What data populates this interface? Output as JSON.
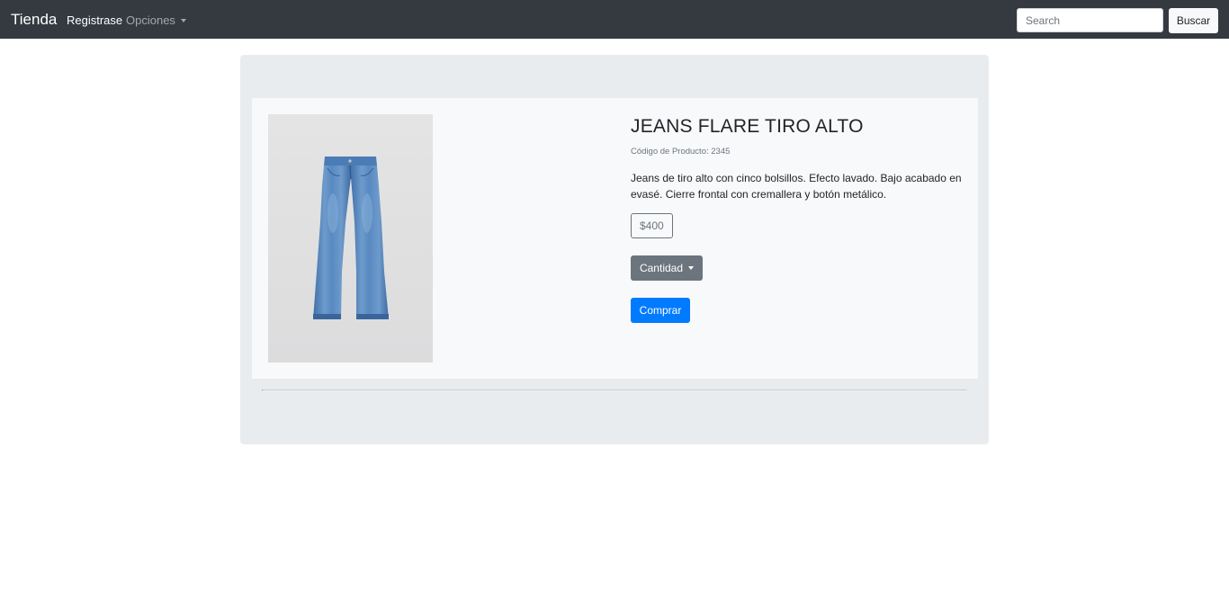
{
  "navbar": {
    "brand": "Tienda",
    "register_link": "Registrase",
    "options_dropdown": "Opciones",
    "search_placeholder": "Search",
    "search_button": "Buscar",
    "background": "#343a40"
  },
  "product": {
    "title": "JEANS FLARE TIRO ALTO",
    "code": "Código de Producto: 2345",
    "description": "Jeans de tiro alto con cinco bolsillos. Efecto lavado. Bajo acabado en evasé. Cierre frontal con cremallera y botón metálico.",
    "price": "$400",
    "quantity_button": "Cantidad",
    "buy_button": "Comprar",
    "image_alt": "jeans-image"
  },
  "colors": {
    "primary": "#007bff",
    "secondary": "#6c757d",
    "jumbotron": "#e9ecef",
    "card": "#f8f9fa"
  }
}
